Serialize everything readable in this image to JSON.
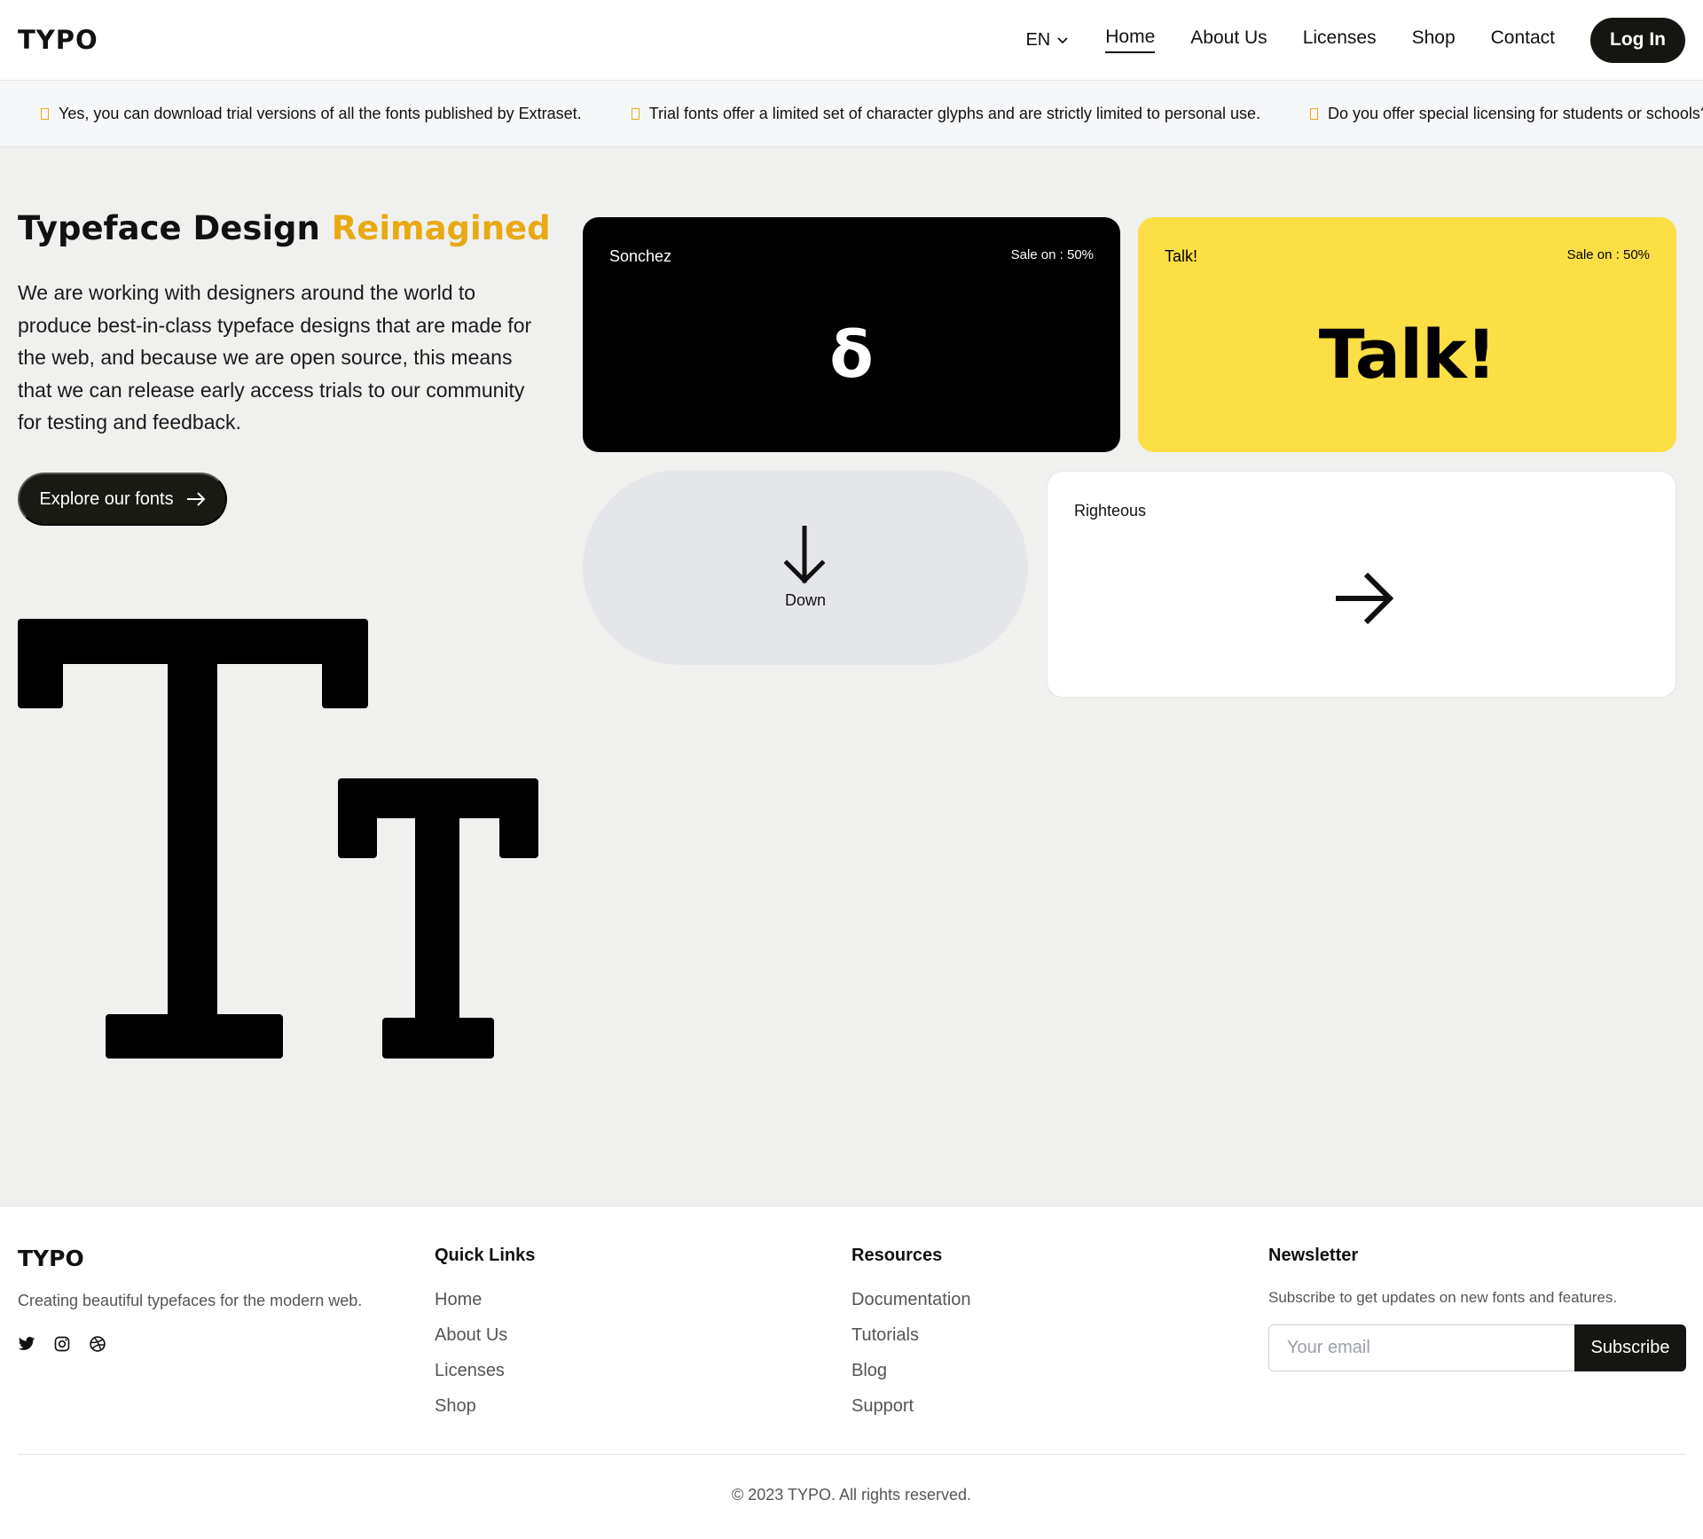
{
  "header": {
    "logo": "TYPO",
    "lang": "EN",
    "nav": [
      "Home",
      "About Us",
      "Licenses",
      "Shop",
      "Contact"
    ],
    "login": "Log In"
  },
  "ticker": [
    "Yes, you can download trial versions of all the fonts published by Extraset.",
    "Trial fonts offer a limited set of character glyphs and are strictly limited to personal use.",
    "Do you offer special licensing for students or schools?"
  ],
  "hero": {
    "title": "Typeface Design",
    "title_accent": "Reimagined",
    "description": "We are working with designers around the world to produce best-in-class typeface designs that are made for the web, and because we are open source, this means that we can release early access trials to our community for testing and feedback.",
    "cta": "Explore our fonts"
  },
  "cards": {
    "sonchez": {
      "label": "Sonchez",
      "sale": "Sale on : 50%",
      "glyph": "δ"
    },
    "talk": {
      "label": "Talk!",
      "sale": "Sale on : 50%",
      "glyph": "Talk!"
    },
    "down": {
      "label": "Down"
    },
    "righteous": {
      "label": "Righteous"
    }
  },
  "footer": {
    "logo": "TYPO",
    "tagline": "Creating beautiful typefaces for the modern web.",
    "quick_links": {
      "title": "Quick Links",
      "items": [
        "Home",
        "About Us",
        "Licenses",
        "Shop"
      ]
    },
    "resources": {
      "title": "Resources",
      "items": [
        "Documentation",
        "Tutorials",
        "Blog",
        "Support"
      ]
    },
    "newsletter": {
      "title": "Newsletter",
      "description": "Subscribe to get updates on new fonts and features.",
      "placeholder": "Your email",
      "button": "Subscribe"
    },
    "copyright": "© 2023 TYPO. All rights reserved."
  },
  "colors": {
    "accent": "#e8a913",
    "yellow_card": "#fcdf44",
    "dark": "#151512"
  },
  "icons": [
    "chevron-down-icon",
    "arrow-right-icon",
    "arrow-down-icon",
    "twitter-icon",
    "instagram-icon",
    "dribbble-icon"
  ]
}
